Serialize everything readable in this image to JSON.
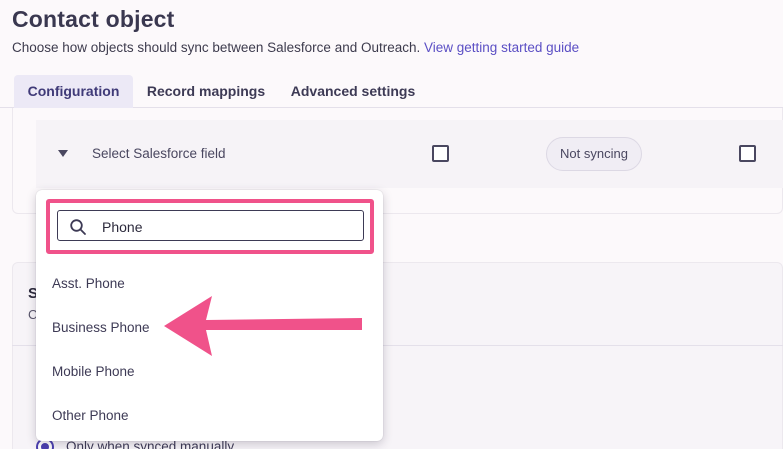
{
  "header": {
    "title": "Contact object",
    "subtitle": "Choose how objects should sync between Salesforce and Outreach.",
    "guide_link": "View getting started guide"
  },
  "tabs": [
    {
      "label": "Configuration",
      "active": true
    },
    {
      "label": "Record mappings",
      "active": false
    },
    {
      "label": "Advanced settings",
      "active": false
    }
  ],
  "field_row": {
    "select_label": "Select Salesforce field",
    "status": "Not syncing"
  },
  "dropdown": {
    "search_value": "Phone",
    "options": [
      "Asst. Phone",
      "Business Phone",
      "Mobile Phone",
      "Other Phone"
    ]
  },
  "section2": {
    "title_fragment": "S",
    "subtitle_fragment": "C",
    "radio_label": "Only when synced manually"
  },
  "colors": {
    "accent": "#5b4fc4",
    "highlight": "#f0528a",
    "background": "#fcf9fb"
  },
  "icons": {
    "search": "search-icon",
    "caret": "caret-down-icon",
    "annotation": "pointer-arrow-icon"
  }
}
